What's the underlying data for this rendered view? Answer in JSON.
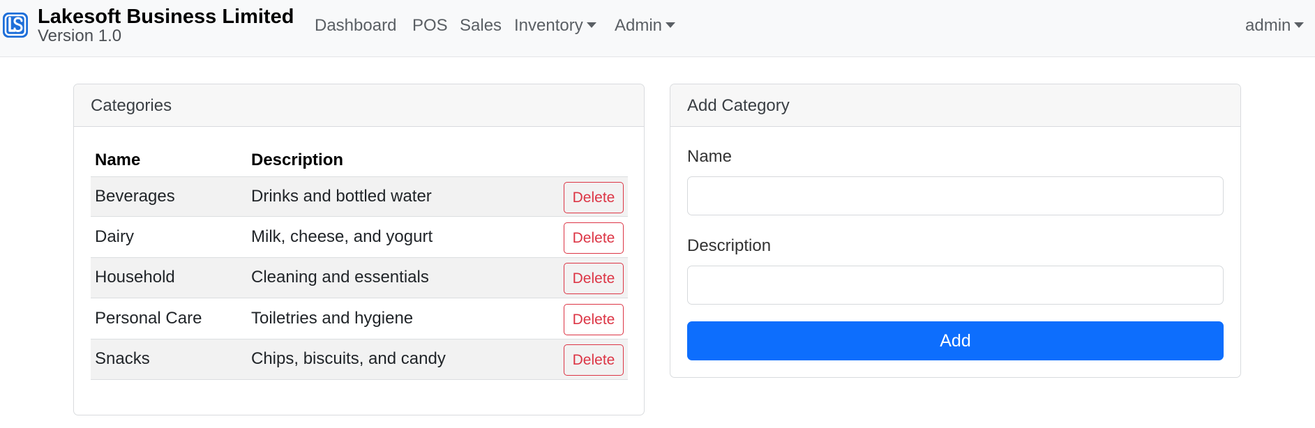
{
  "brand": {
    "title": "Lakesoft Business Limited",
    "version": "Version 1.0"
  },
  "nav": {
    "dashboard": "Dashboard",
    "pos": "POS",
    "sales": "Sales",
    "inventory": "Inventory",
    "admin": "Admin",
    "user": "admin"
  },
  "categories": {
    "title": "Categories",
    "columns": {
      "name": "Name",
      "description": "Description"
    },
    "delete_label": "Delete",
    "rows": [
      {
        "name": "Beverages",
        "description": "Drinks and bottled water"
      },
      {
        "name": "Dairy",
        "description": "Milk, cheese, and yogurt"
      },
      {
        "name": "Household",
        "description": "Cleaning and essentials"
      },
      {
        "name": "Personal Care",
        "description": "Toiletries and hygiene"
      },
      {
        "name": "Snacks",
        "description": "Chips, biscuits, and candy"
      }
    ]
  },
  "add_category": {
    "title": "Add Category",
    "name_label": "Name",
    "name_value": "",
    "description_label": "Description",
    "description_value": "",
    "add_label": "Add"
  },
  "colors": {
    "primary": "#0d6efd",
    "danger": "#dc3545",
    "navbar_bg": "#f8f9fa"
  }
}
